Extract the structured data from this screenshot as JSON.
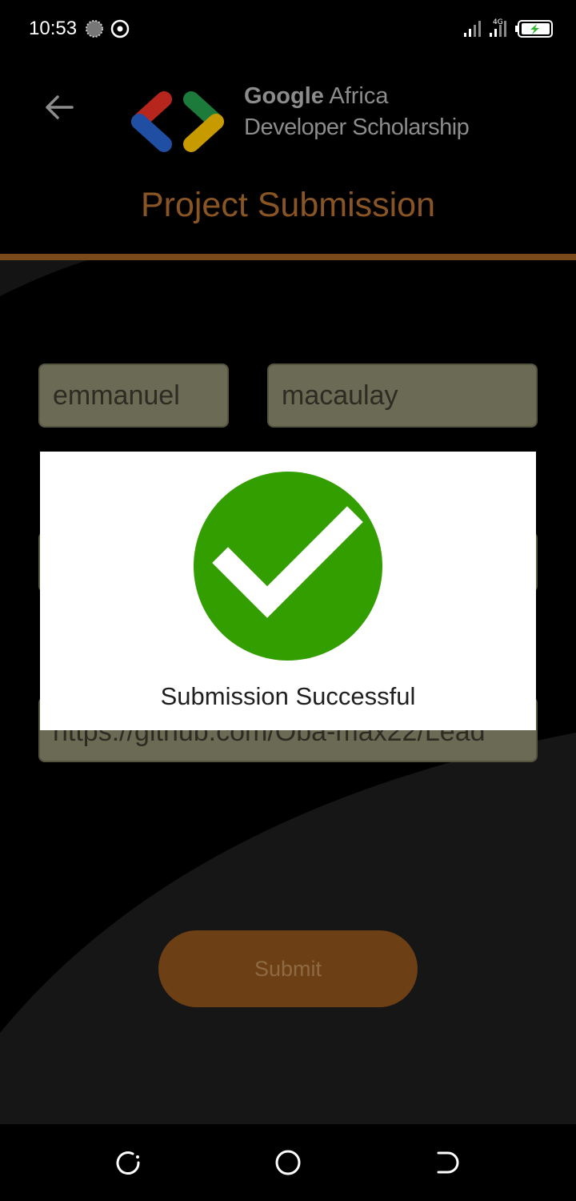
{
  "status_bar": {
    "time": "10:53",
    "network": "4G"
  },
  "header": {
    "brand_google": "Google",
    "brand_africa": " Africa",
    "brand_line2": "Developer Scholarship",
    "title": "Project Submission"
  },
  "form": {
    "first_name": "emmanuel",
    "last_name": "macaulay",
    "email": "",
    "github_link": "https://github.com/Oba-max22/Lead",
    "submit_label": "Submit"
  },
  "dialog": {
    "message": "Submission Successful"
  },
  "colors": {
    "accent": "#7a4a1b",
    "title": "#8a5524",
    "success": "#339e00",
    "field_bg": "#6b6a55"
  },
  "icons": {
    "back": "arrow-left-icon",
    "check": "check-circle-icon",
    "recents": "recents-icon",
    "home": "home-icon",
    "back_nav": "back-nav-icon"
  }
}
